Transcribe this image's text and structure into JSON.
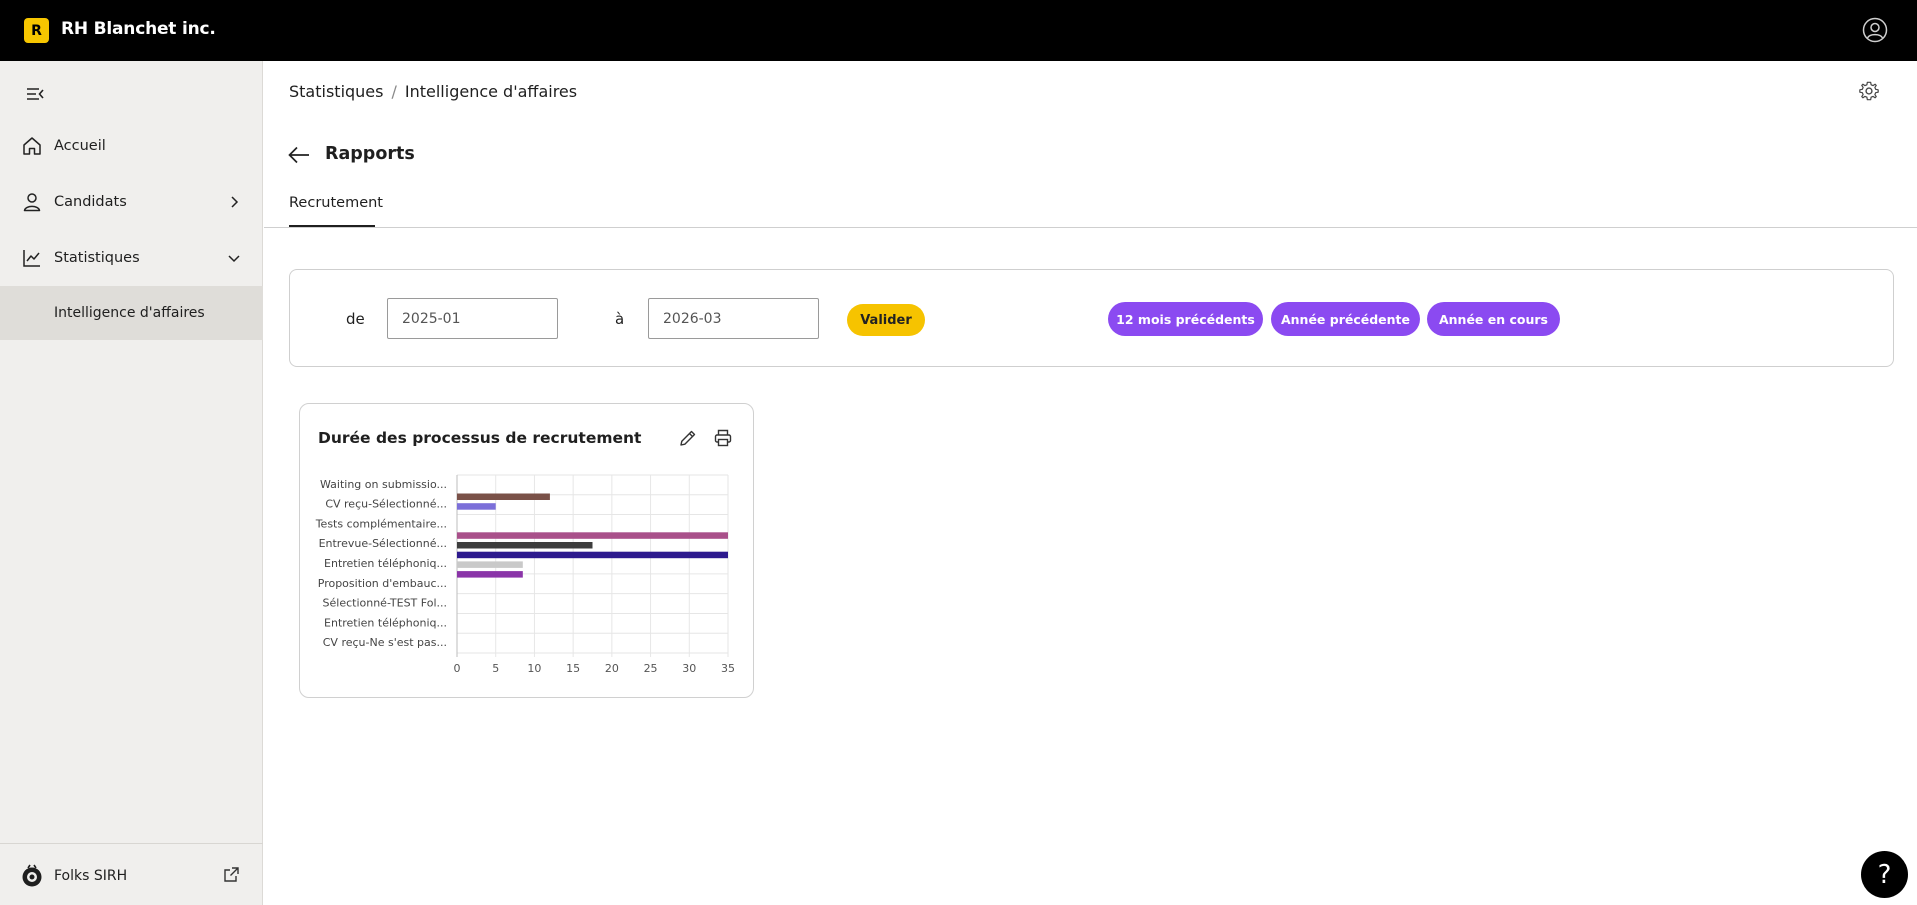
{
  "app": {
    "logo_letter": "R",
    "brand": "RH Blanchet inc."
  },
  "sidebar": {
    "items": [
      {
        "label": "Accueil"
      },
      {
        "label": "Candidats"
      },
      {
        "label": "Statistiques"
      },
      {
        "label": "Intelligence d'affaires"
      }
    ],
    "footer": {
      "label": "Folks SIRH"
    }
  },
  "breadcrumb": {
    "parent": "Statistiques",
    "separator": "/",
    "current": "Intelligence d'affaires"
  },
  "page": {
    "title": "Rapports",
    "tab": "Recrutement"
  },
  "filters": {
    "from_label": "de",
    "from_value": "2025-01",
    "to_label": "à",
    "to_value": "2026-03",
    "submit": "Valider",
    "quick": [
      "12 mois précédents",
      "Année précédente",
      "Année en cours"
    ]
  },
  "report": {
    "title": "Durée des processus de recrutement"
  },
  "chart_data": {
    "type": "bar",
    "orientation": "horizontal",
    "categories": [
      "Waiting on submissio...",
      "CV reçu-Sélectionné...",
      "Tests complémentaire...",
      "Entrevue-Sélectionné...",
      "Entretien téléphoniq...",
      "Proposition d'embauc...",
      "Sélectionné-TEST Fol...",
      "Entretien téléphoniq...",
      "CV reçu-Ne s'est pas..."
    ],
    "xlim": [
      0,
      35
    ],
    "xticks": [
      0,
      5,
      10,
      15,
      20,
      25,
      30,
      35
    ],
    "grid": true,
    "bars": [
      {
        "value": 12,
        "color": "#7a5148"
      },
      {
        "value": 5,
        "color": "#7b6fd9"
      },
      {
        "value": 35,
        "color": "#a9508a"
      },
      {
        "value": 17.5,
        "color": "#3d3d3d"
      },
      {
        "value": 35,
        "color": "#2d1a8e"
      },
      {
        "value": 8.5,
        "color": "#c9c9c9"
      },
      {
        "value": 8.5,
        "color": "#8a34a8"
      }
    ]
  },
  "help": {
    "label": "?"
  }
}
